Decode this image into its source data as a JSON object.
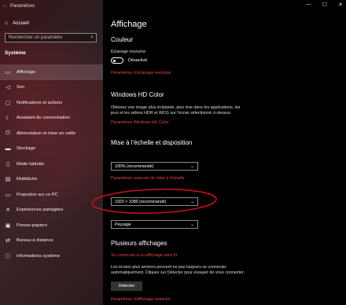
{
  "window": {
    "title": "Paramètres"
  },
  "sidebar": {
    "home_label": "Accueil",
    "search_placeholder": "Rechercher un paramètre",
    "section_label": "Système",
    "items": [
      {
        "label": "Affichage",
        "icon": "monitor-icon"
      },
      {
        "label": "Son",
        "icon": "speaker-icon"
      },
      {
        "label": "Notifications et actions",
        "icon": "notification-icon"
      },
      {
        "label": "Assistant de concentration",
        "icon": "moon-icon"
      },
      {
        "label": "Alimentation et mise en veille",
        "icon": "power-icon"
      },
      {
        "label": "Stockage",
        "icon": "storage-icon"
      },
      {
        "label": "Mode tablette",
        "icon": "tablet-icon"
      },
      {
        "label": "Multitâche",
        "icon": "multitask-icon"
      },
      {
        "label": "Projection sur ce PC",
        "icon": "projection-icon"
      },
      {
        "label": "Expériences partagées",
        "icon": "share-icon"
      },
      {
        "label": "Presse-papiers",
        "icon": "clipboard-icon"
      },
      {
        "label": "Bureau à distance",
        "icon": "remote-desktop-icon"
      },
      {
        "label": "Informations système",
        "icon": "info-icon"
      }
    ]
  },
  "main": {
    "title": "Affichage",
    "couleur": {
      "heading": "Couleur",
      "night_light_label": "Éclairage nocturne",
      "toggle_state": "Désactivé",
      "night_light_link": "Paramètres d'éclairage nocturne"
    },
    "hdr": {
      "heading": "Windows HD Color",
      "desc_line1": "Obtenez une image plus éclatante, plus vive dans les applications, les",
      "desc_line2": "jeux et les vidéos HDR et WCG sur l'écran sélectionné ci-dessus.",
      "link": "Paramètres Windows HD Color"
    },
    "scale": {
      "heading": "Mise à l'échelle et disposition",
      "scale_value": "100% (recommandé)",
      "advanced_link": "Paramètres avancés de mise à l'échelle",
      "resolution_value": "1920 × 1080 (recommandé)",
      "orientation_value": "Paysage"
    },
    "multi": {
      "heading": "Plusieurs affichages",
      "wireless_link": "Se connecter à un affichage sans fil",
      "desc_line1": "Les écrans plus anciens peuvent ne pas toujours se connecter",
      "desc_line2": "automatiquement. Cliquez sur Détecter pour essayer de vous connecter.",
      "detect_button": "Détecter",
      "advanced_link": "Paramètres d'affichage avancés"
    }
  }
}
